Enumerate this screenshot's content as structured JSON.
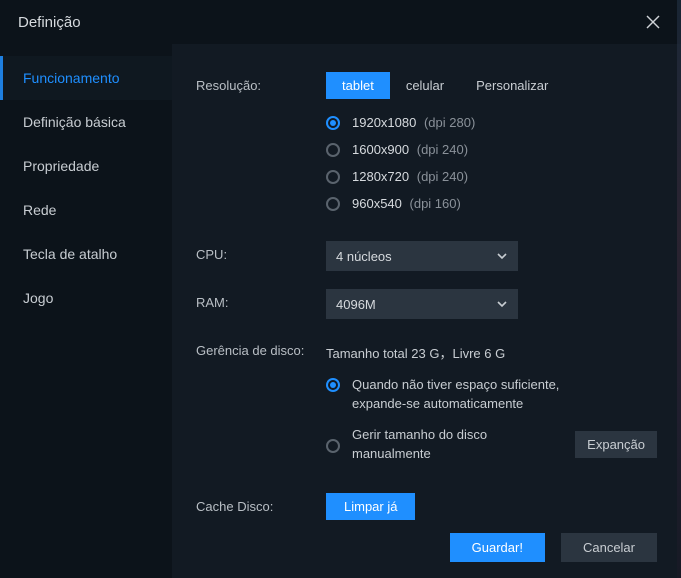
{
  "window": {
    "title": "Definição"
  },
  "sidebar": {
    "items": [
      {
        "label": "Funcionamento"
      },
      {
        "label": "Definição básica"
      },
      {
        "label": "Propriedade"
      },
      {
        "label": "Rede"
      },
      {
        "label": "Tecla de atalho"
      },
      {
        "label": "Jogo"
      }
    ]
  },
  "labels": {
    "resolution": "Resolução:",
    "cpu": "CPU:",
    "ram": "RAM:",
    "disk": "Gerência de disco:",
    "cache": "Cache Disco:"
  },
  "resolution": {
    "tabs": {
      "tablet": "tablet",
      "celular": "celular",
      "custom": "Personalizar"
    },
    "options": [
      {
        "res": "1920x1080",
        "dpi": "(dpi 280)"
      },
      {
        "res": "1600x900",
        "dpi": "(dpi 240)"
      },
      {
        "res": "1280x720",
        "dpi": "(dpi 240)"
      },
      {
        "res": "960x540",
        "dpi": "(dpi 160)"
      }
    ]
  },
  "cpu": {
    "value": "4 núcleos"
  },
  "ram": {
    "value": "4096M"
  },
  "disk": {
    "status": "Tamanho total 23 G，Livre 6 G",
    "opt_auto": "Quando não tiver espaço suficiente, expande-se automaticamente",
    "opt_manual": "Gerir tamanho do disco manualmente",
    "expand_btn": "Expanção"
  },
  "cache": {
    "clear_btn": "Limpar já"
  },
  "footer": {
    "save": "Guardar!",
    "cancel": "Cancelar"
  }
}
